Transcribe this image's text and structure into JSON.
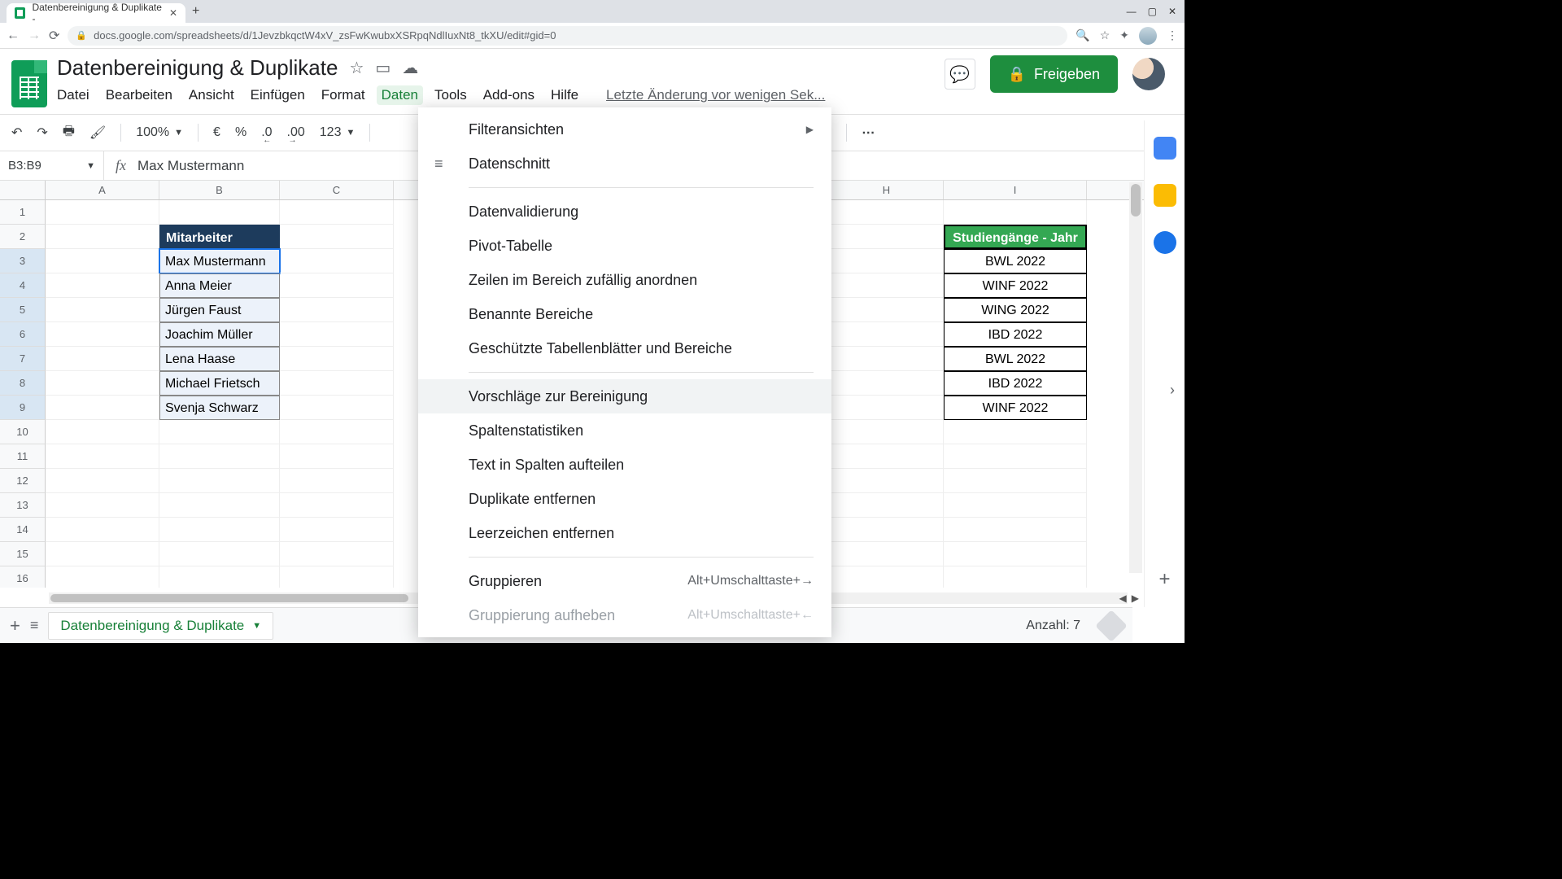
{
  "browser": {
    "tab_title": "Datenbereinigung & Duplikate -",
    "url": "docs.google.com/spreadsheets/d/1JevzbkqctW4xV_zsFwKwubxXSRpqNdlIuxNt8_tkXU/edit#gid=0"
  },
  "doc": {
    "title": "Datenbereinigung & Duplikate",
    "last_edit": "Letzte Änderung vor wenigen Sek..."
  },
  "menus": {
    "file": "Datei",
    "edit": "Bearbeiten",
    "view": "Ansicht",
    "insert": "Einfügen",
    "format": "Format",
    "data": "Daten",
    "tools": "Tools",
    "addons": "Add-ons",
    "help": "Hilfe"
  },
  "share": {
    "label": "Freigeben"
  },
  "toolbar": {
    "zoom": "100%",
    "currency": "€",
    "percent": "%",
    "dec_dec": ".0",
    "dec_inc": ".00",
    "more_fmt": "123"
  },
  "namebox": "B3:B9",
  "formula_value": "Max Mustermann",
  "columns": {
    "A": "A",
    "B": "B",
    "C": "C",
    "H": "H",
    "I": "I"
  },
  "rows": [
    "1",
    "2",
    "3",
    "4",
    "5",
    "6",
    "7",
    "8",
    "9",
    "10",
    "11",
    "12",
    "13",
    "14",
    "15",
    "16"
  ],
  "mitarbeiter": {
    "header": "Mitarbeiter",
    "items": [
      "Max Mustermann",
      "Anna Meier",
      "Jürgen Faust",
      "Joachim Müller",
      "Lena Haase",
      "Michael Frietsch",
      "Svenja Schwarz"
    ]
  },
  "studien": {
    "header": "Studiengänge - Jahr",
    "items": [
      "BWL 2022",
      "WINF 2022",
      "WING 2022",
      "IBD 2022",
      "BWL 2022",
      "IBD 2022",
      "WINF 2022"
    ]
  },
  "data_menu": {
    "filter_views": "Filteransichten",
    "slicer": "Datenschnitt",
    "validation": "Datenvalidierung",
    "pivot": "Pivot-Tabelle",
    "randomize": "Zeilen im Bereich zufällig anordnen",
    "named_ranges": "Benannte Bereiche",
    "protected": "Geschützte Tabellenblätter und Bereiche",
    "cleanup_suggestions": "Vorschläge zur Bereinigung",
    "column_stats": "Spaltenstatistiken",
    "split_text": "Text in Spalten aufteilen",
    "remove_dupes": "Duplikate entfernen",
    "trim_ws": "Leerzeichen entfernen",
    "group": "Gruppieren",
    "group_sc": "Alt+Umschalttaste+→",
    "ungroup": "Gruppierung aufheben",
    "ungroup_sc": "Alt+Umschalttaste+←"
  },
  "sheet_tab": "Datenbereinigung & Duplikate",
  "status": {
    "count": "Anzahl: 7"
  }
}
